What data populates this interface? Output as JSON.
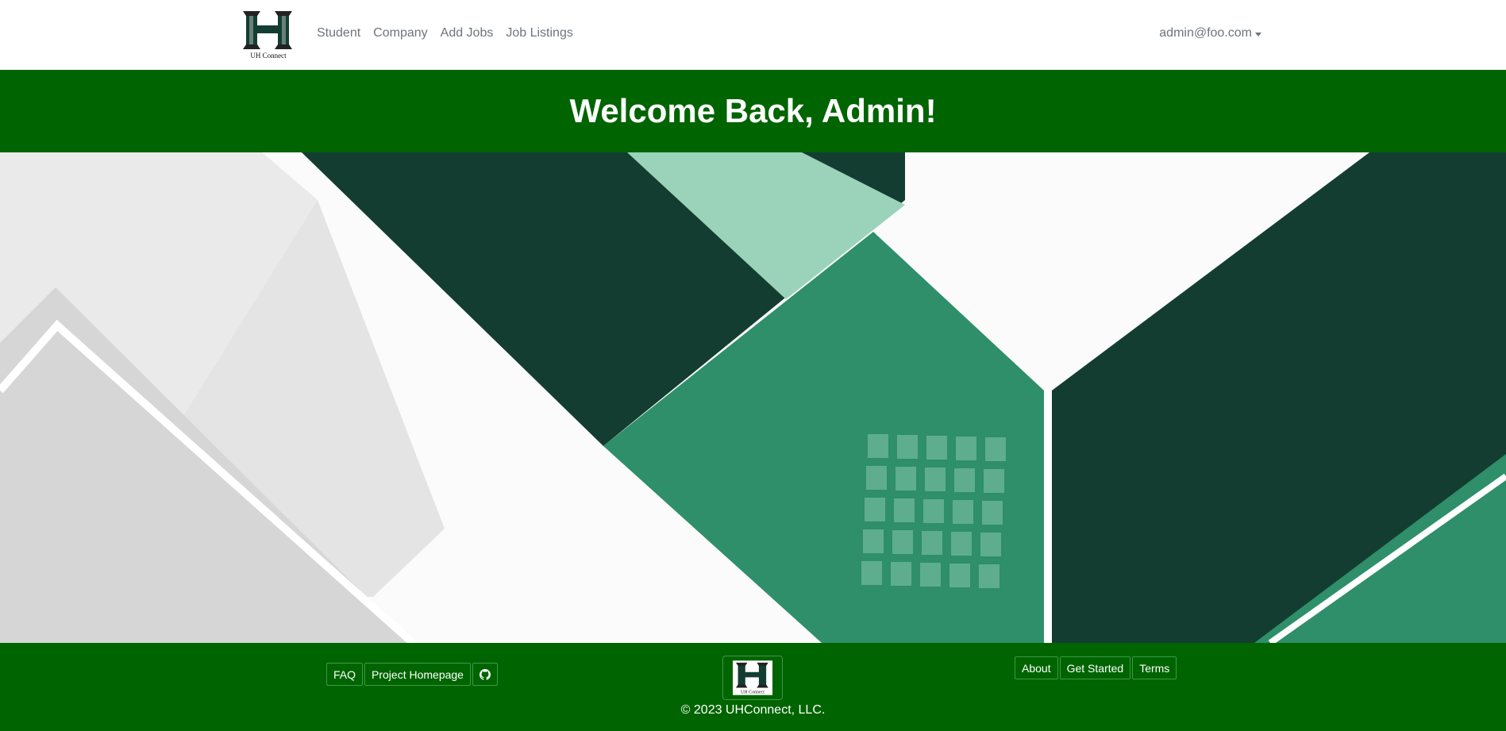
{
  "navbar": {
    "logo_caption": "UH Connect",
    "links": [
      {
        "label": "Student"
      },
      {
        "label": "Company"
      },
      {
        "label": "Add Jobs"
      },
      {
        "label": "Job Listings"
      }
    ],
    "user_menu": "admin@foo.com"
  },
  "banner": {
    "title": "Welcome Back, Admin!"
  },
  "footer": {
    "left_links": [
      {
        "label": "FAQ"
      },
      {
        "label": "Project Homepage"
      }
    ],
    "github_icon": "github-icon",
    "logo_caption": "UH Connect",
    "right_links": [
      {
        "label": "About"
      },
      {
        "label": "Get Started"
      },
      {
        "label": "Terms"
      }
    ],
    "copyright": "© 2023 UHConnect, LLC."
  },
  "colors": {
    "brand_green": "#006400",
    "dark_green": "#143d31",
    "mid_green": "#2e8f6a",
    "light_green": "#9bd3ba"
  }
}
